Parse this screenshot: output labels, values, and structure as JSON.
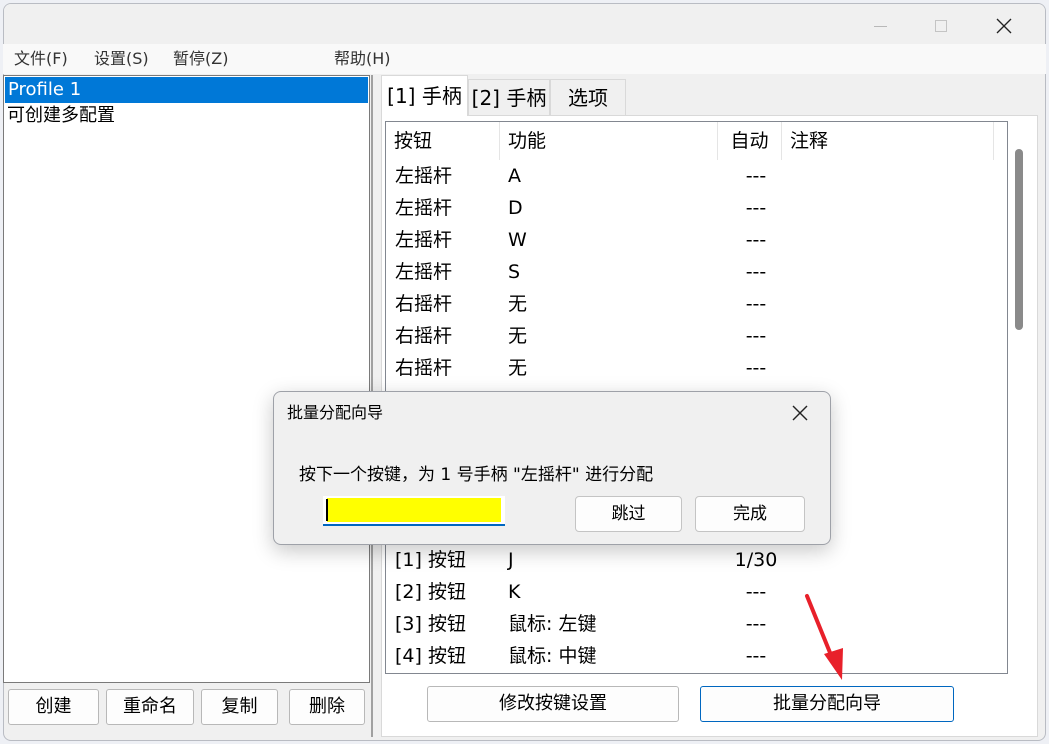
{
  "menu": [
    "文件(F)",
    "设置(S)",
    "暂停(Z)",
    "帮助(H)"
  ],
  "profiles": [
    "Profile 1",
    "可创建多配置"
  ],
  "profile_buttons": {
    "create": "创建",
    "rename": "重命名",
    "copy": "复制",
    "delete": "删除"
  },
  "tabs": [
    "[1] 手柄",
    "[2] 手柄",
    "选项"
  ],
  "table": {
    "headers": [
      "按钮",
      "功能",
      "自动",
      "注释"
    ],
    "rows_top": [
      [
        "左摇杆",
        "A",
        "---",
        ""
      ],
      [
        "左摇杆",
        "D",
        "---",
        ""
      ],
      [
        "左摇杆",
        "W",
        "---",
        ""
      ],
      [
        "左摇杆",
        "S",
        "---",
        ""
      ],
      [
        "右摇杆",
        "无",
        "---",
        ""
      ],
      [
        "右摇杆",
        "无",
        "---",
        ""
      ],
      [
        "右摇杆",
        "无",
        "---",
        ""
      ]
    ],
    "rows_bottom": [
      [
        "[1] 按钮",
        "J",
        "1/30",
        ""
      ],
      [
        "[2] 按钮",
        "K",
        "---",
        ""
      ],
      [
        "[3] 按钮",
        "鼠标: 左键",
        "---",
        ""
      ],
      [
        "[4] 按钮",
        "鼠标: 中键",
        "---",
        ""
      ]
    ]
  },
  "bottom_buttons": {
    "modify": "修改按键设置",
    "batch": "批量分配向导"
  },
  "dialog": {
    "title": "批量分配向导",
    "message": "按下一个按键，为 1 号手柄  \"左摇杆\"  进行分配",
    "skip": "跳过",
    "done": "完成",
    "input_color": "#ffff00"
  },
  "colors": {
    "selection": "#0078d7",
    "focus_border": "#0067c0",
    "arrow": "#e8202a"
  }
}
